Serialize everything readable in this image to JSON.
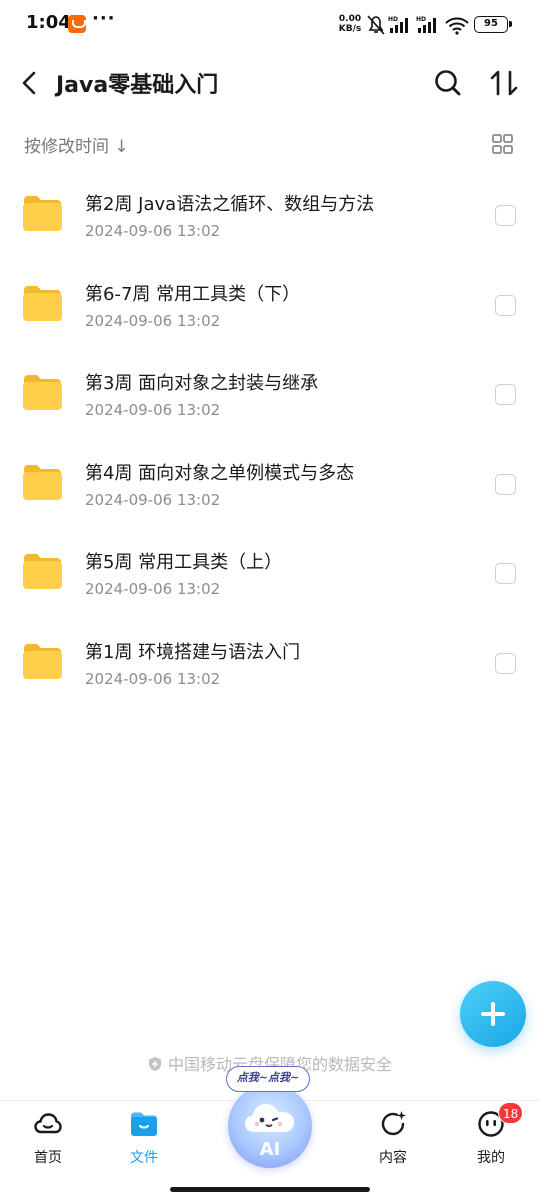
{
  "status_bar": {
    "time": "1:04",
    "net_speed_value": "0.00",
    "net_speed_unit": "KB/s",
    "network_label_1": "HD",
    "network_label_2": "HD",
    "battery": "95",
    "icons": [
      "taobao-app-icon",
      "more-dots-icon",
      "mute-bell-icon",
      "signal-icon",
      "signal-icon",
      "wifi-icon",
      "battery-icon"
    ]
  },
  "header": {
    "title": "Java零基础入门",
    "icons": [
      "back-icon",
      "search-icon",
      "sort-icon"
    ]
  },
  "sort_bar": {
    "label": "按修改时间 ↓",
    "icon": "grid-view-icon"
  },
  "files": [
    {
      "name": "第2周 Java语法之循环、数组与方法",
      "date": "2024-09-06 13:02",
      "icon": "folder-icon",
      "checked": false
    },
    {
      "name": "第6-7周 常用工具类（下）",
      "date": "2024-09-06 13:02",
      "icon": "folder-icon",
      "checked": false
    },
    {
      "name": "第3周 面向对象之封装与继承",
      "date": "2024-09-06 13:02",
      "icon": "folder-icon",
      "checked": false
    },
    {
      "name": "第4周 面向对象之单例模式与多态",
      "date": "2024-09-06 13:02",
      "icon": "folder-icon",
      "checked": false
    },
    {
      "name": "第5周 常用工具类（上）",
      "date": "2024-09-06 13:02",
      "icon": "folder-icon",
      "checked": false
    },
    {
      "name": "第1周 环境搭建与语法入门",
      "date": "2024-09-06 13:02",
      "icon": "folder-icon",
      "checked": false
    }
  ],
  "fab": {
    "icon": "plus-icon"
  },
  "security_note": "中国移动云盘保障您的数据安全",
  "ai": {
    "bubble": "点我~点我~",
    "label": "AI"
  },
  "nav": {
    "home": "首页",
    "files": "文件",
    "content": "内容",
    "mine": "我的",
    "mine_badge": "18",
    "active": "files"
  },
  "colors": {
    "accent": "#1a9fe8",
    "folder": "#ffcf4a",
    "badge": "#f23a3a"
  }
}
